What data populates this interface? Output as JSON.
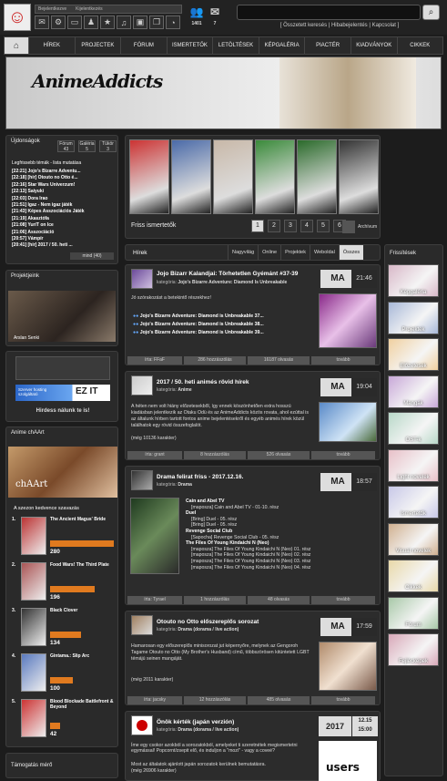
{
  "header": {
    "login_placeholder": "Bejelentkezve",
    "register": "Kijelentkezés",
    "users_count": "1401",
    "messages_count": "7",
    "search_links": "[ Összetett keresés | Hibabejelentés | Kapcsolat ]"
  },
  "icons": [
    "mail-icon",
    "gear-icon",
    "monitor-icon",
    "person-icon",
    "star-icon",
    "music-icon",
    "image-icon",
    "chat-icon",
    "history-icon"
  ],
  "nav": [
    "HÍREK",
    "PROJECTEK",
    "FÓRUM",
    "ISMERTETŐK",
    "LETÖLTÉSEK",
    "KÉPGALÉRIA",
    "PIACTÉR",
    "KIADVÁNYOK",
    "CIKKEK"
  ],
  "banner": {
    "logo": "AnimeAddicts"
  },
  "ujdonsagok": {
    "title": "Újdonságok",
    "tabs": [
      "Fórum",
      "Galéria",
      "Tükör"
    ],
    "tab_counts": [
      "43",
      "5",
      "3"
    ],
    "list_title": "Legfrissebb témák - lista mutatása",
    "items": [
      {
        "t": "[22:21]",
        "s": "Jojo's Bizarre Adventu..."
      },
      {
        "t": "[22:18]",
        "s": "[hír] Otouto no Otto é..."
      },
      {
        "t": "[22:16]",
        "s": "Star Wars Univerzum!"
      },
      {
        "t": "[22:13]",
        "s": "Saiyuki"
      },
      {
        "t": "[22:03]",
        "s": "Dora Irao"
      },
      {
        "t": "[21:51]",
        "s": "Igaz - Nem igaz játék"
      },
      {
        "t": "[21:43]",
        "s": "Képes Asszociációs Játék"
      },
      {
        "t": "[21:19]",
        "s": "Akasztófa"
      },
      {
        "t": "[21:08]",
        "s": "YuriT on Ice"
      },
      {
        "t": "[21:06]",
        "s": "Asszociáció"
      },
      {
        "t": "[20:57]",
        "s": "Vámpír"
      },
      {
        "t": "[20:41]",
        "s": "[hír] 2017 / 50. heti ..."
      }
    ],
    "all": "mind (40)"
  },
  "projektek": {
    "title": "Projektjeink",
    "caption": "Arslan Senki"
  },
  "ad": {
    "caption": "Hirdess nálunk te is!",
    "logo": "EZ IT",
    "text1": "Szerver hosting",
    "text2": "szolgáltató"
  },
  "chaart": {
    "title": "Anime chAArt",
    "banner": "chAArt",
    "vote_title": "A szezon kedvence szavazás",
    "votes": [
      {
        "n": "1.",
        "name": "The Ancient Magus' Bride",
        "v": 280
      },
      {
        "n": "2.",
        "name": "Food Wars! The Third Plate",
        "v": 196
      },
      {
        "n": "3.",
        "name": "Black Clover",
        "v": 134
      },
      {
        "n": "4.",
        "name": "Gintama.: Slip Arc",
        "v": 100
      },
      {
        "n": "5.",
        "name": "Blood Blockade Battlefront & Beyond",
        "v": 42
      }
    ]
  },
  "tamogatas": {
    "title": "Támogatás mérő"
  },
  "friss": {
    "title": "Friss ismertetők",
    "pages": [
      "1",
      "2",
      "3",
      "4",
      "5",
      "6"
    ],
    "archive": "Archívum"
  },
  "news": {
    "title": "Hírek",
    "tabs": [
      "Nagyvilág",
      "Online",
      "Projektek",
      "Weboldal",
      "Összes"
    ],
    "posts": [
      {
        "title": "Jojo Bizarr Kalandjai: Törhetetlen Gyémánt #37-39",
        "kat_label": "kategória:",
        "kat": "Jojo's Bizarre Adventure: Diamond Is Unbreakable",
        "date": "MA",
        "time": "21:46",
        "text": "Jó szórakozást a betekintő részekhez!",
        "links": [
          "Jojo's Bizarre Adventure: Diamond is Unbreakable 37...",
          "Jojo's Bizarre Adventure: Diamond is Unbreakable 38...",
          "Jojo's Bizarre Adventure: Diamond is Unbreakable 39..."
        ],
        "foot": [
          "írta: FFaF",
          "286 hozzászólás",
          "16187 olvasás",
          "tovább"
        ]
      },
      {
        "title": "2017 / 50. heti animés rövid hírek",
        "kat_label": "kategória:",
        "kat": "Anime",
        "date": "MA",
        "time": "19:04",
        "text": "A héten nem volt hiány előzetesekből, így ennek köszönhetően extra hosszú kiadásban jelentkezik az Otaku Odü és az AnimeAddicts közös rovata, ahol ezúttal is az általunk hírben tartott fontos anime bejelentésekről és egyéb animés hírek közül találhatok egy rövid összefoglalót.",
        "more": "(még 10136 karakter)",
        "foot": [
          "írta: grant",
          "8 hozzászólás",
          "526 olvasás",
          "tovább"
        ]
      },
      {
        "title": "Drama felirat friss - 2017.12.16.",
        "kat_label": "kategória:",
        "kat": "Drama",
        "date": "MA",
        "time": "18:57",
        "lines": [
          "Cain and Abel TV",
          "[maposza] Cain and Abel TV - 01-10. rész",
          "Duel",
          "[Bring] Duel - 05. rész",
          "[Bring] Duel - 05. rész",
          "Revenge Social Club",
          "[Sapocha] Revenge Social Club - 05. rész",
          "The Files Of Young Kindaichi N (Neo)",
          "[maposza] The Files Of Young Kindaichi N (Neo) 01. rész",
          "[maposza] The Files Of Young Kindaichi N (Neo) 02. rész",
          "[maposza] The Files Of Young Kindaichi N (Neo) 03. rész",
          "[maposza] The Files Of Young Kindaichi N (Neo) 04. rész"
        ],
        "foot": [
          "írta: Tyrael",
          "1 hozzászólás",
          "48 olvasás",
          "tovább"
        ]
      },
      {
        "title": "Otouto no Otto előszereplős sorozat",
        "kat_label": "kategória:",
        "kat": "Drama (dorama / live action)",
        "date": "MA",
        "time": "17:59",
        "text": "Hamarosan egy előszereplős minisorozat jut képernyőre, melynek az Gengoroh Tagame Otouto no Otto (My Brother's Husband) című, többszörösen kitüntetett LGBT témájú seinen mangáját.",
        "more": "(még 2011 karakter)",
        "foot": [
          "írta: jacsky",
          "12 hozzászólás",
          "485 olvasás",
          "tovább"
        ]
      },
      {
        "title": "Önök kérték (japán verzión)",
        "kat_label": "kategória:",
        "kat": "Drama (dorama / live action)",
        "date": "2017",
        "time": "12.15",
        "time2": "15:00",
        "text": "Íme egy csokor azokból a sorozatokból, amelyeket ti szeretnétek megismertetni egymással! Popcornt/zsepit elő, és induljon a \"mozi\" - vagy a coveé?",
        "text2": "Most az általatok ajánlott japán sorozatok kerülnek bemutatásra.",
        "more": "(még 26906 karakter)",
        "logo": "users"
      }
    ]
  },
  "frissitesek": {
    "title": "Frissítések",
    "items": [
      "Képgaléria",
      "Projektek",
      "Előzetesek",
      "Mangák",
      "OST-k",
      "Light novelek",
      "Ismertetők",
      "Visual novelek",
      "Cikkek",
      "Fórum",
      "Fejlécképek"
    ]
  }
}
